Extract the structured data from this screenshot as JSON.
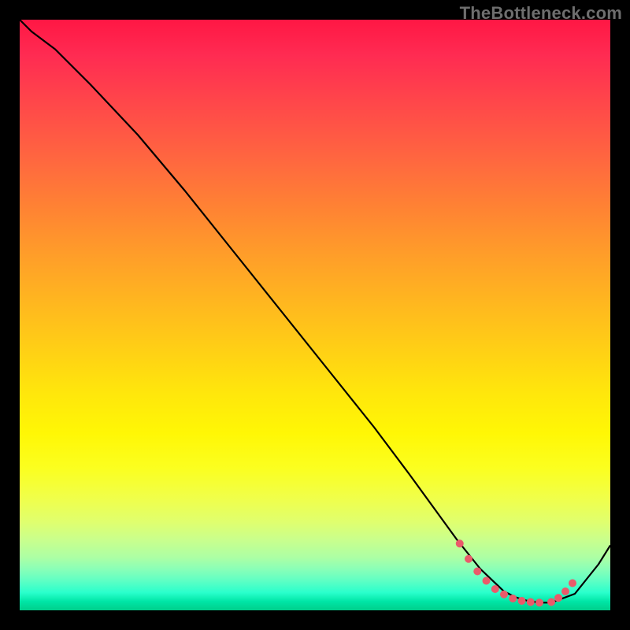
{
  "watermark": "TheBottleneck.com",
  "colors": {
    "curve_stroke": "#000000",
    "highlight_dot_fill": "#ea5a6a",
    "highlight_dot_stroke": "#ea5a6a",
    "background": "#000000"
  },
  "chart_data": {
    "type": "line",
    "title": "",
    "xlabel": "",
    "ylabel": "",
    "xlim": [
      0,
      100
    ],
    "ylim": [
      0,
      100
    ],
    "grid": false,
    "series": [
      {
        "name": "curve",
        "x": [
          0,
          2,
          6,
          12,
          20,
          28,
          36,
          44,
          52,
          60,
          66,
          70,
          74,
          78,
          82,
          84,
          86,
          88,
          90,
          94,
          98,
          100
        ],
        "values": [
          100,
          98,
          95,
          89,
          80.5,
          71,
          61,
          51,
          41,
          31,
          23,
          17.5,
          12,
          7,
          3.2,
          2.2,
          1.6,
          1.3,
          1.3,
          2.8,
          7.8,
          11
        ]
      }
    ],
    "highlights": [
      {
        "name": "near-minimum-dots",
        "x": [
          74.5,
          76,
          77.5,
          79,
          80.5,
          82,
          83.5,
          85,
          86.5,
          88,
          90,
          91.2,
          92.4,
          93.6
        ],
        "values": [
          11.3,
          8.7,
          6.6,
          5.0,
          3.6,
          2.7,
          2.0,
          1.6,
          1.4,
          1.3,
          1.4,
          2.1,
          3.2,
          4.6
        ]
      }
    ]
  }
}
